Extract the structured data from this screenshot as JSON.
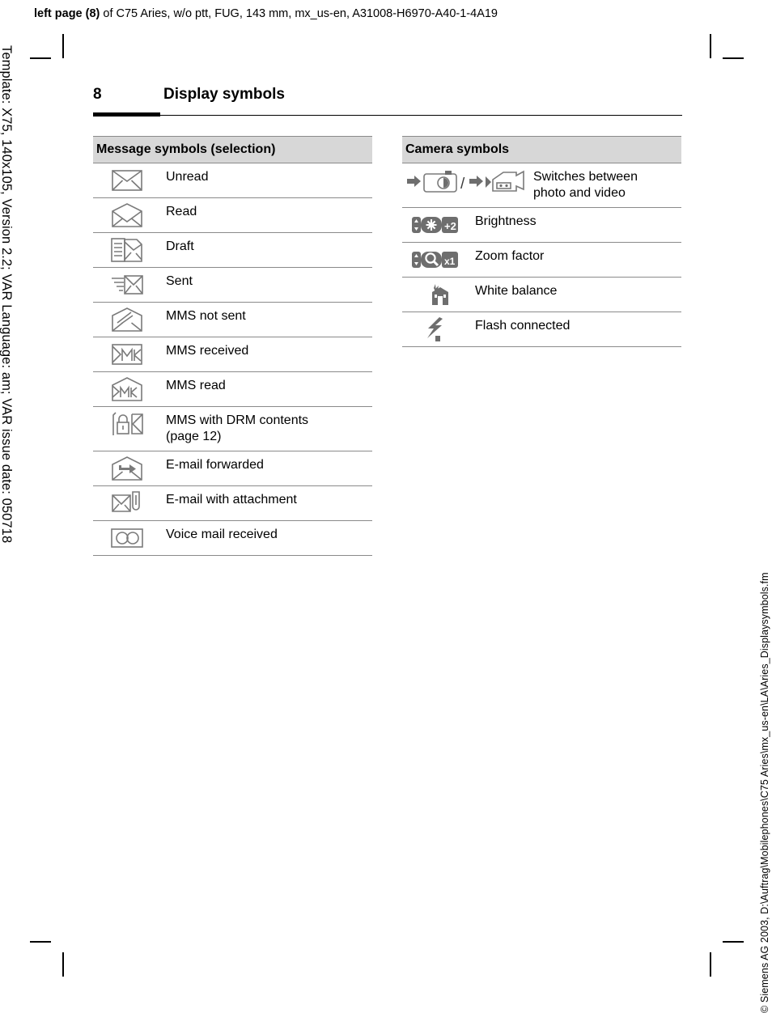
{
  "header": {
    "lead": "left page (8)",
    "rest": " of C75 Aries, w/o ptt, FUG, 143 mm, mx_us-en, A31008-H6970-A40-1-4A19"
  },
  "margins": {
    "left_note": "Template: X75, 140x105, Version 2.2; VAR Language: am; VAR issue date: 050718",
    "right_note": "© Siemens AG 2003, D:\\Auftrag\\Mobilephones\\C75 Aries\\mx_us-en\\LA\\Aries_Displaysymbols.fm"
  },
  "page": {
    "number": "8",
    "title": "Display symbols"
  },
  "tables": [
    {
      "id": "message-symbols",
      "heading": "Message symbols (selection)",
      "rows": [
        {
          "icon": "envelope-closed-icon",
          "label": "Unread"
        },
        {
          "icon": "envelope-open-icon",
          "label": "Read"
        },
        {
          "icon": "draft-page-envelope-icon",
          "label": "Draft"
        },
        {
          "icon": "envelope-sent-icon",
          "label": "Sent"
        },
        {
          "icon": "mms-not-sent-icon",
          "label": "MMS not sent"
        },
        {
          "icon": "mms-received-icon",
          "label": "MMS received"
        },
        {
          "icon": "mms-read-icon",
          "label": "MMS read"
        },
        {
          "icon": "mms-drm-icon",
          "label": "MMS with DRM contents",
          "label2": "(page 12)"
        },
        {
          "icon": "email-forwarded-icon",
          "label": "E-mail forwarded"
        },
        {
          "icon": "email-attachment-icon",
          "label": "E-mail with attachment"
        },
        {
          "icon": "voice-mail-icon",
          "label": "Voice mail received"
        }
      ]
    },
    {
      "id": "camera-symbols",
      "heading": "Camera symbols",
      "rows": [
        {
          "icon": "photo-video-toggle-icon",
          "label": "Switches between",
          "label2": "photo and video",
          "separator": "/"
        },
        {
          "icon": "brightness-icon",
          "label": "Brightness",
          "badge": "+2"
        },
        {
          "icon": "zoom-factor-icon",
          "label": "Zoom factor",
          "badge": "x1"
        },
        {
          "icon": "white-balance-icon",
          "label": "White balance"
        },
        {
          "icon": "flash-connected-icon",
          "label": "Flash connected"
        }
      ]
    }
  ]
}
